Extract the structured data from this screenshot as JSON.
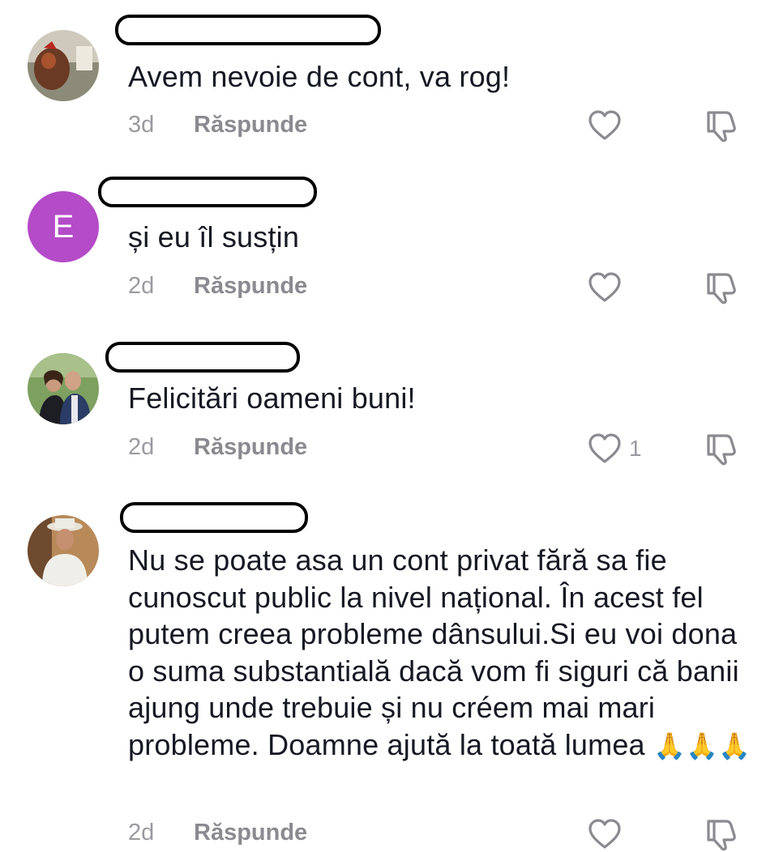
{
  "comments": [
    {
      "text": "Avem nevoie de cont, va rog!",
      "time": "3d",
      "reply_label": "Răspunde",
      "likes": "",
      "avatar_icon": "user-photo-icon"
    },
    {
      "text": "și eu îl susțin",
      "time": "2d",
      "reply_label": "Răspunde",
      "likes": "",
      "avatar_letter": "E",
      "avatar_color": "#b44bc8"
    },
    {
      "text": "Felicitări oameni buni!",
      "time": "2d",
      "reply_label": "Răspunde",
      "likes": "1",
      "avatar_icon": "user-photo-icon"
    },
    {
      "text": "Nu se poate asa un cont privat fără sa fie cunoscut public la nivel național. În acest fel putem creea probleme dânsului.Si eu voi dona o suma substantială dacă vom fi siguri că banii ajung unde trebuie și nu créem mai mari probleme. Doamne ajută la toată lumea",
      "emojis": "🙏🙏🙏",
      "time": "2d",
      "reply_label": "Răspunde",
      "likes": "",
      "avatar_icon": "user-photo-icon"
    }
  ],
  "icons": {
    "like": "heart-outline-icon",
    "dislike": "thumbs-down-icon"
  },
  "colors": {
    "text": "#161823",
    "meta": "#9a9aa0",
    "redaction_border": "#000000"
  }
}
